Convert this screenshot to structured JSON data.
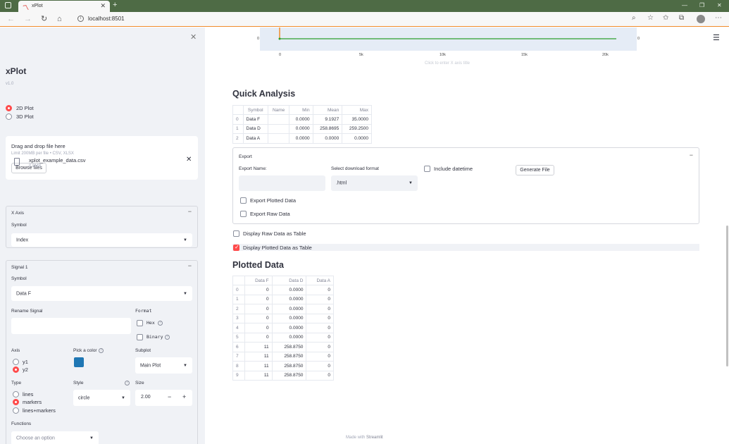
{
  "browser": {
    "tab_title": "xPlot",
    "url": "localhost:8501",
    "new_tab": "+",
    "back": "←",
    "forward": "→",
    "reload": "↻",
    "home": "⌂",
    "minimize": "—",
    "restore": "❐",
    "close": "✕"
  },
  "sidebar": {
    "close": "✕",
    "title": "xPlot",
    "version": "v1.0",
    "plot_modes": [
      "2D Plot",
      "3D Plot"
    ],
    "plot_mode_selected": "2D Plot",
    "uploader": {
      "title": "Drag and drop file here",
      "limit": "Limit 200MB per file • CSV, XLSX",
      "browse": "Browse files"
    },
    "file": {
      "name": "xplot_example_data.csv",
      "size": "0.8MB",
      "remove": "✕"
    },
    "x_axis": {
      "title": "X Axis",
      "toggle": "−",
      "symbol_label": "Symbol",
      "symbol_value": "Index"
    },
    "signal": {
      "title": "Signal 1",
      "toggle": "−",
      "symbol_label": "Symbol",
      "symbol_value": "Data F",
      "rename_label": "Rename Signal",
      "rename_value": "",
      "format_label": "Format",
      "hex_label": "Hex",
      "binary_label": "Binary",
      "axis_label": "Axis",
      "axis_options": [
        "y1",
        "y2"
      ],
      "axis_selected": "y2",
      "color_label": "Pick a color",
      "color": "#1f77b4",
      "subplot_label": "Subplot",
      "subplot_value": "Main Plot",
      "type_label": "Type",
      "type_options": [
        "lines",
        "markers",
        "lines+markers"
      ],
      "type_selected": "markers",
      "style_label": "Style",
      "style_value": "circle",
      "size_label": "Size",
      "size_value": "2.00",
      "minus": "−",
      "plus": "+",
      "functions_label": "Functions",
      "functions_placeholder": "Choose an option"
    }
  },
  "chart": {
    "y_tick": "0",
    "y2_tick": "0",
    "x_ticks": [
      "0",
      "5k",
      "10k",
      "15k",
      "20k"
    ],
    "x_hint": "Click to enter X axis title"
  },
  "quick_analysis": {
    "title": "Quick Analysis",
    "columns": [
      "",
      "Symbol",
      "Name",
      "Min",
      "Mean",
      "Max"
    ],
    "rows": [
      [
        "0",
        "Data F",
        "",
        "0.0000",
        "9.1927",
        "35.0000"
      ],
      [
        "1",
        "Data D",
        "",
        "0.0000",
        "258.8695",
        "259.2500"
      ],
      [
        "2",
        "Data A",
        "",
        "0.0000",
        "0.0000",
        "0.0000"
      ]
    ]
  },
  "export": {
    "title": "Export",
    "toggle": "−",
    "name_label": "Export Name:",
    "name_value": "",
    "format_label": "Select download format",
    "format_value": ".html",
    "include_datetime": "Include datetime",
    "generate": "Generate File",
    "plotted": "Export Plotted Data",
    "raw": "Export Raw Data"
  },
  "display_raw": "Display Raw Data as Table",
  "display_plotted": "Display Plotted Data as Table",
  "plotted_data": {
    "title": "Plotted Data",
    "columns": [
      "",
      "Data F",
      "Data D",
      "Data A"
    ],
    "rows": [
      [
        "0",
        "0",
        "0.0000",
        "0"
      ],
      [
        "1",
        "0",
        "0.0000",
        "0"
      ],
      [
        "2",
        "0",
        "0.0000",
        "0"
      ],
      [
        "3",
        "0",
        "0.0000",
        "0"
      ],
      [
        "4",
        "0",
        "0.0000",
        "0"
      ],
      [
        "5",
        "0",
        "0.0000",
        "0"
      ],
      [
        "6",
        "11",
        "258.8750",
        "0"
      ],
      [
        "7",
        "11",
        "258.8750",
        "0"
      ],
      [
        "8",
        "11",
        "258.8750",
        "0"
      ],
      [
        "9",
        "11",
        "258.8750",
        "0"
      ]
    ]
  },
  "footer": {
    "prefix": "Made with",
    "brand": "Streamlit"
  },
  "colors": {
    "accent": "#ff4b4b",
    "chrome_tab_bar": "#4e6b45",
    "sidebar_bg": "#f0f2f6",
    "plot_bg": "#e5ecf6",
    "trace_green": "#2ca02c",
    "cursor_orange": "#f08c2b"
  }
}
